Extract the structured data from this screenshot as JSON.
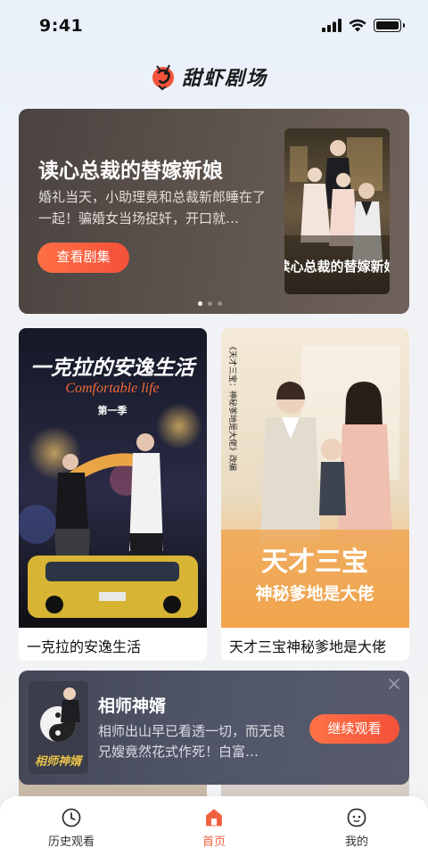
{
  "status_bar": {
    "time": "9:41"
  },
  "app": {
    "name": "甜虾剧场"
  },
  "hero": {
    "title": "读心总裁的替嫁新娘",
    "description": "婚礼当天，小助理竟和总裁新郎睡在了一起！骗婚女当场捉奸，开口就…",
    "button_label": "查看剧集",
    "poster_text": "读心总裁的替嫁新娘",
    "slide_count": 3,
    "active_slide": 1
  },
  "dramas": [
    {
      "title": "一克拉的安逸生活",
      "poster_title": "一克拉的安逸生活",
      "poster_subtitle": "Comfortable life",
      "poster_tag": "第一季"
    },
    {
      "title": "天才三宝神秘爹地是大佬",
      "poster_title": "天才三宝",
      "poster_subtitle": "神秘爹地是大佬",
      "poster_side_text": "《天才三宝：神秘爹地是大佬》改编"
    }
  ],
  "continue_watching": {
    "title": "相师神婿",
    "description": "相师出山早已看透一切，而无良兄嫂竟然花式作死！白富…",
    "button_label": "继续观看",
    "poster_text": "相师神婿"
  },
  "tabs": [
    {
      "label": "历史观看",
      "icon": "clock-icon",
      "active": false
    },
    {
      "label": "首页",
      "icon": "home-icon",
      "active": true
    },
    {
      "label": "我的",
      "icon": "profile-icon",
      "active": false
    }
  ],
  "colors": {
    "accent": "#f2613f",
    "tab_active": "#f2613f"
  }
}
